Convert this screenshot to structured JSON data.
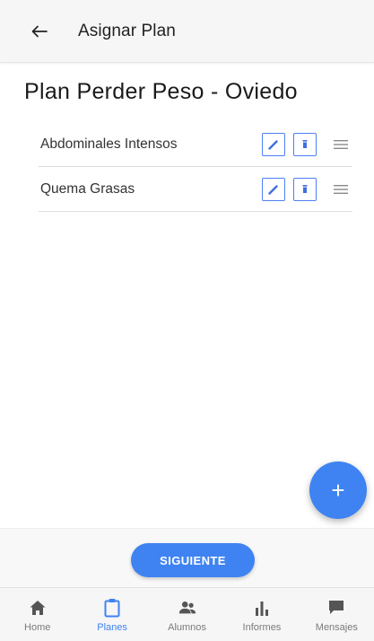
{
  "header": {
    "title": "Asignar Plan",
    "back_icon": "arrow-left-icon"
  },
  "plan": {
    "title": "Plan Perder Peso - Oviedo"
  },
  "workouts": [
    {
      "label": "Abdominales Intensos"
    },
    {
      "label": "Quema Grasas"
    }
  ],
  "fab": {
    "label": "+"
  },
  "next_button": {
    "label": "SIGUIENTE"
  },
  "bottom_nav": [
    {
      "label": "Home",
      "icon": "home-icon",
      "active": false
    },
    {
      "label": "Planes",
      "icon": "clipboard-icon",
      "active": true
    },
    {
      "label": "Alumnos",
      "icon": "users-icon",
      "active": false
    },
    {
      "label": "Informes",
      "icon": "bar-chart-icon",
      "active": false
    },
    {
      "label": "Mensajes",
      "icon": "chat-icon",
      "active": false
    }
  ],
  "colors": {
    "accent": "#3f83f2",
    "icon_gray": "#555555"
  }
}
